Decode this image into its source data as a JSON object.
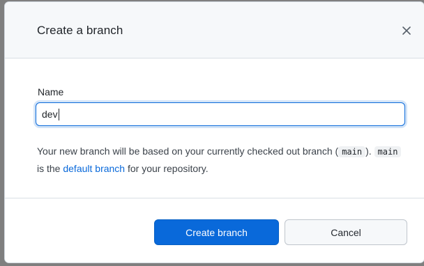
{
  "dialog": {
    "title": "Create a branch",
    "close_icon": "close-icon",
    "name_label": "Name",
    "name_value": "dev",
    "description": {
      "part1": "Your new branch will be based on your currently checked out branch (",
      "current_branch": "main",
      "part2": "). ",
      "default_branch_code": "main",
      "part3": " is the ",
      "default_branch_link": "default branch",
      "part4": " for your repository."
    },
    "create_button": "Create branch",
    "cancel_button": "Cancel"
  },
  "colors": {
    "accent": "#0969da",
    "header_bg": "#f6f8fa"
  }
}
